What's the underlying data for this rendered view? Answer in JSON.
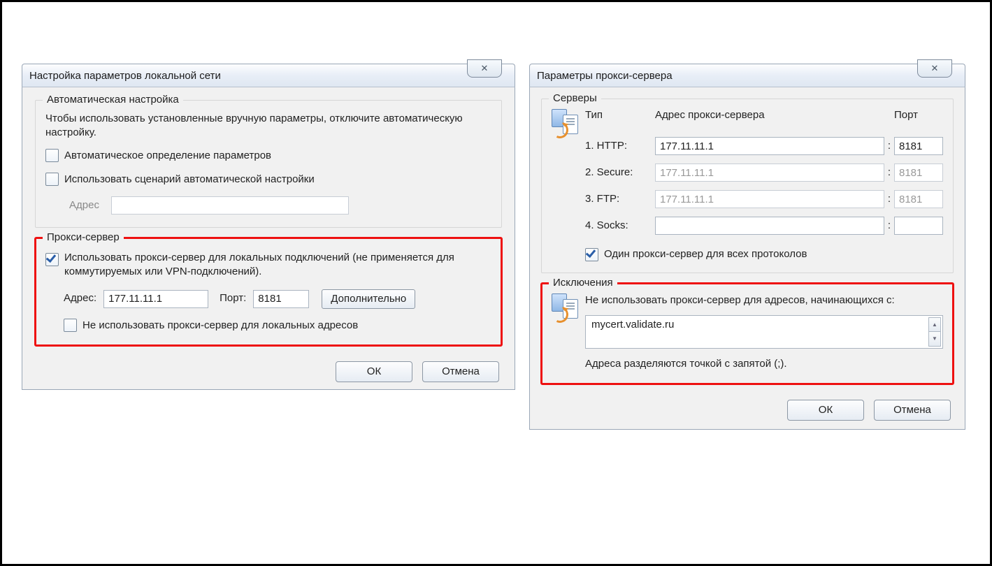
{
  "lan": {
    "title": "Настройка параметров локальной сети",
    "close_glyph": "✕",
    "auto": {
      "legend": "Автоматическая настройка",
      "note": "Чтобы использовать установленные вручную параметры, отключите автоматическую настройку.",
      "detect_label": "Автоматическое определение параметров",
      "script_label": "Использовать сценарий автоматической настройки",
      "address_label": "Адрес"
    },
    "proxy": {
      "legend": "Прокси-сервер",
      "use_label": "Использовать прокси-сервер для локальных подключений (не применяется для коммутируемых или VPN-подключений).",
      "address_label": "Адрес:",
      "address_value": "177.11.11.1",
      "port_label": "Порт:",
      "port_value": "8181",
      "advanced_label": "Дополнительно",
      "bypass_local_label": "Не использовать прокси-сервер для локальных адресов"
    },
    "ok_label": "ОК",
    "cancel_label": "Отмена"
  },
  "adv": {
    "title": "Параметры прокси-сервера",
    "close_glyph": "✕",
    "servers": {
      "legend": "Серверы",
      "col_type": "Тип",
      "col_addr": "Адрес прокси-сервера",
      "col_port": "Порт",
      "rows": [
        {
          "label": "1. HTTP:",
          "addr": "177.11.11.1",
          "port": "8181",
          "disabled": false
        },
        {
          "label": "2. Secure:",
          "addr": "177.11.11.1",
          "port": "8181",
          "disabled": true
        },
        {
          "label": "3. FTP:",
          "addr": "177.11.11.1",
          "port": "8181",
          "disabled": true
        },
        {
          "label": "4. Socks:",
          "addr": "",
          "port": "",
          "disabled": false
        }
      ],
      "same_label": "Один прокси-сервер для всех протоколов"
    },
    "exceptions": {
      "legend": "Исключения",
      "note": "Не использовать прокси-сервер для адресов, начинающихся с:",
      "value": "mycert.validate.ru",
      "hint": "Адреса разделяются точкой с запятой (;)."
    },
    "ok_label": "ОК",
    "cancel_label": "Отмена"
  }
}
